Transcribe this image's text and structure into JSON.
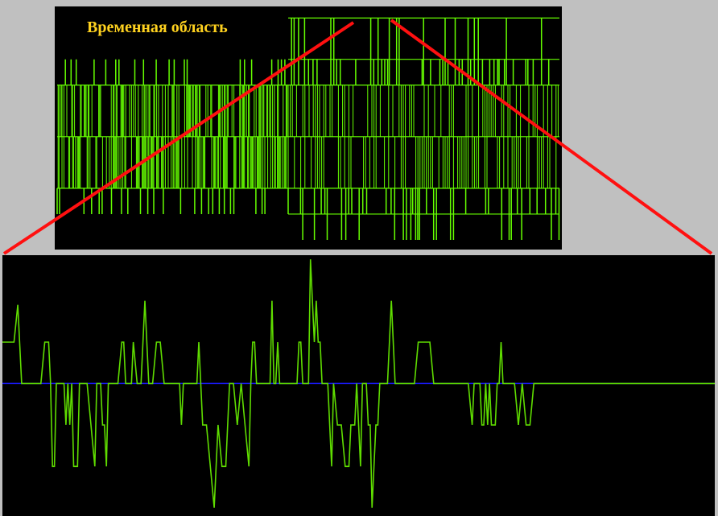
{
  "colors": {
    "background": "#c0c0c0",
    "panel": "#000000",
    "signal": "#66ff00",
    "zoom_signal": "#5fdc00",
    "baseline": "#1a1aff",
    "title": "#ffd21f",
    "zoom_lines": "#ff1010"
  },
  "title": "Временная область",
  "chart_data": [
    {
      "type": "line",
      "title": "Временная область",
      "xlabel": "",
      "ylabel": "",
      "grid": false,
      "description_units": "normalized amplitude levels",
      "ylim": [
        -2,
        2.4
      ],
      "levels": [
        2.3,
        1.5,
        0.5,
        -0.5,
        -1.5,
        -2
      ],
      "dense_band": [
        -1.0,
        1.0
      ],
      "segments": [
        {
          "x_range": [
            0,
            0.46
          ],
          "spike_levels": [
            1.5,
            -1.5
          ],
          "activity": "dense"
        },
        {
          "x_range": [
            0.46,
            1.0
          ],
          "spike_levels": [
            2.3,
            1.5,
            -1.5,
            -2.0
          ],
          "activity": "sparse"
        }
      ]
    },
    {
      "type": "line",
      "title": "",
      "xlabel": "",
      "ylabel": "",
      "grid": false,
      "baseline": 0,
      "ylim": [
        -3.2,
        3.1
      ],
      "x": [
        0,
        2,
        4,
        6,
        8,
        10,
        11,
        12,
        13,
        14,
        16,
        18,
        20,
        22,
        23,
        24,
        25,
        26,
        27,
        28,
        29,
        30,
        31,
        32,
        33,
        34,
        35,
        36,
        37,
        38,
        39,
        40,
        42,
        44,
        46,
        48,
        49,
        50,
        51,
        52,
        53,
        54,
        55,
        56,
        57,
        58,
        59,
        60,
        62,
        63,
        64,
        65,
        66,
        67,
        68,
        70,
        72,
        74,
        76,
        78,
        80,
        82,
        84,
        85,
        86,
        87,
        88,
        89,
        90,
        91,
        92,
        93,
        94,
        95,
        96,
        97,
        98,
        99,
        100,
        101,
        102,
        103,
        104,
        106,
        108,
        110,
        112,
        114,
        116,
        118,
        120,
        122,
        124,
        126,
        128,
        129,
        130,
        131,
        132,
        133,
        134,
        135,
        136,
        137,
        138,
        139,
        140,
        141,
        142,
        143,
        144,
        146,
        148,
        150,
        151,
        152,
        153,
        154,
        155,
        156,
        157,
        158,
        159,
        160,
        161,
        162,
        163,
        164,
        165,
        166,
        167,
        168,
        169,
        170,
        171,
        172,
        174,
        176,
        178,
        180,
        181,
        182,
        183,
        184,
        185,
        186,
        187,
        188,
        189,
        190,
        191,
        192,
        193,
        194,
        195,
        196,
        197,
        198,
        199,
        200,
        202,
        204,
        206,
        208,
        210,
        212,
        214,
        216,
        218,
        220,
        222,
        224,
        226,
        228,
        230,
        232,
        234,
        236,
        238,
        240,
        242,
        244,
        245,
        246,
        247,
        248,
        249,
        250,
        251,
        252,
        253,
        254,
        255,
        256,
        257,
        258,
        259,
        260,
        262,
        264,
        266,
        268,
        270,
        272,
        274,
        276,
        278,
        280,
        282,
        284,
        286,
        288,
        290,
        292,
        294,
        296,
        298,
        300,
        302,
        304,
        306,
        308,
        310,
        312,
        314,
        316,
        318,
        320,
        322,
        324,
        326,
        328,
        330,
        332,
        334,
        336,
        338,
        340,
        342,
        344,
        346,
        348,
        350,
        352,
        354,
        356,
        358,
        360,
        362,
        364,
        366,
        368,
        370
      ],
      "values": [
        1,
        1,
        1,
        1,
        1.9,
        0,
        0,
        0,
        0,
        0,
        0,
        0,
        0,
        1,
        1,
        1,
        0,
        -2,
        -2,
        0,
        0,
        0,
        0,
        0,
        -1,
        0,
        -1,
        0,
        -2,
        -2,
        -2,
        0,
        0,
        0,
        -1,
        -2,
        0,
        0,
        0,
        -1,
        -1,
        -2,
        0,
        0,
        0,
        0,
        0,
        0,
        1,
        1,
        0,
        0,
        0,
        0,
        1,
        0,
        0,
        2,
        0,
        0,
        1,
        1,
        0,
        0,
        0,
        0,
        0,
        0,
        0,
        0,
        0,
        -1,
        0,
        0,
        0,
        0,
        0,
        0,
        0,
        0,
        1,
        0,
        -1,
        -1,
        -2,
        -3,
        -1,
        -2,
        -2,
        0,
        0,
        -1,
        0,
        -1,
        -2,
        0,
        1,
        1,
        0,
        0,
        0,
        0,
        0,
        0,
        0,
        0,
        2,
        0,
        0,
        1,
        0,
        0,
        0,
        0,
        0,
        0,
        0,
        1,
        1,
        0,
        0,
        0,
        0,
        3,
        2,
        1,
        2,
        1,
        1,
        0,
        0,
        0,
        0,
        -1,
        -2,
        0,
        -1,
        -1,
        -2,
        -2,
        -1,
        -1,
        -1,
        0,
        -1,
        -2,
        0,
        0,
        0,
        -1,
        -1,
        -3,
        -2,
        -1,
        -1,
        0,
        0,
        0,
        0,
        0,
        2,
        0,
        0,
        0,
        0,
        0,
        0,
        1,
        1,
        1,
        1,
        0,
        0,
        0,
        0,
        0,
        0,
        0,
        0,
        0,
        0,
        -1,
        0,
        0,
        0,
        0,
        -1,
        -1,
        0,
        -1,
        0,
        -1,
        -1,
        -1,
        0,
        0,
        1,
        0,
        0,
        0,
        0,
        -1,
        0,
        -1,
        -1,
        0,
        0,
        0,
        0,
        0,
        0,
        0,
        0,
        0,
        0,
        0,
        0,
        0,
        0,
        0,
        0,
        0,
        0,
        0,
        0,
        0,
        0,
        0,
        0,
        0,
        0,
        0,
        0,
        0,
        0,
        0,
        0,
        0,
        0,
        0,
        0,
        0,
        0,
        0,
        0,
        0,
        0,
        0,
        0,
        0,
        0,
        0,
        0,
        0,
        0,
        0,
        0,
        0,
        0,
        0
      ]
    }
  ]
}
